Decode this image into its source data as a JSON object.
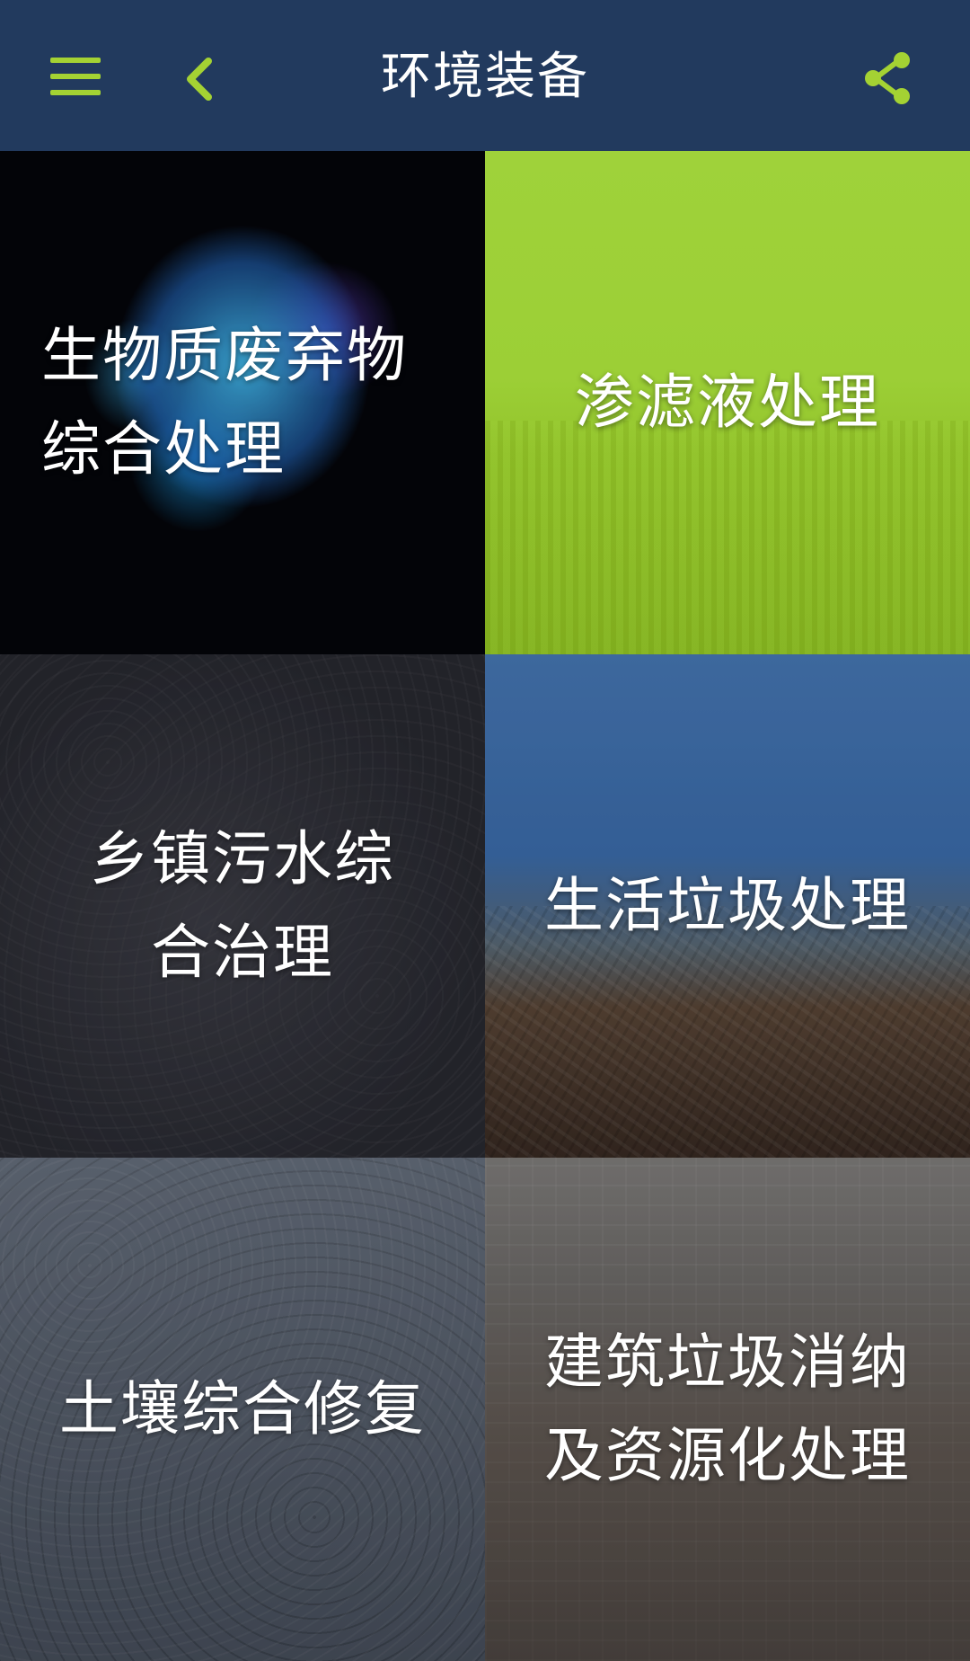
{
  "header": {
    "title": "环境装备",
    "icons": {
      "menu": "menu-icon",
      "back": "back-icon",
      "share": "share-icon"
    },
    "accent_color": "#a4d233",
    "bar_color": "#223a5e"
  },
  "tiles": [
    {
      "lines": [
        "生物质废弃物",
        "综合处理"
      ]
    },
    {
      "lines": [
        "渗滤液处理"
      ]
    },
    {
      "lines": [
        "乡镇污水综",
        "合治理"
      ]
    },
    {
      "lines": [
        "生活垃圾处理"
      ]
    },
    {
      "lines": [
        "土壤综合修复"
      ]
    },
    {
      "lines": [
        "建筑垃圾消纳",
        "及资源化处理"
      ]
    }
  ]
}
